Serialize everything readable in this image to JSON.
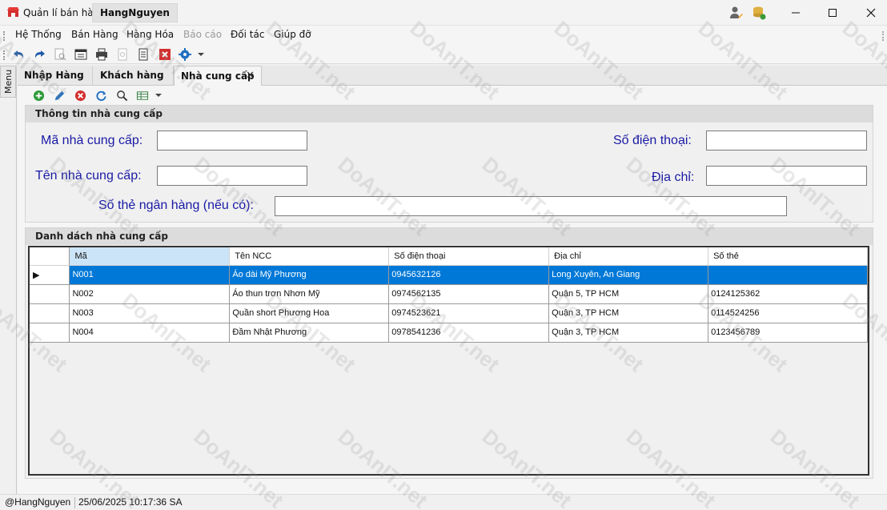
{
  "titlebar": {
    "app_title": "Quản lí bán hàng",
    "user_tab": "HangNguyen"
  },
  "menu": {
    "items": [
      {
        "label": "Hệ Thống",
        "enabled": true
      },
      {
        "label": "Bán Hàng",
        "enabled": true
      },
      {
        "label": "Hàng Hóa",
        "enabled": true
      },
      {
        "label": "Báo cáo",
        "enabled": false
      },
      {
        "label": "Đối tác",
        "enabled": true
      },
      {
        "label": "Giúp đỡ",
        "enabled": true
      }
    ]
  },
  "toolbar": {
    "icons": [
      "undo-icon",
      "redo-icon",
      "print-preview-icon",
      "form-icon",
      "print-icon",
      "page-icon",
      "document-icon",
      "delete-icon",
      "settings-icon",
      "dropdown-arrow-icon"
    ]
  },
  "side_menu": {
    "label": "Menu"
  },
  "tabs": [
    {
      "label": "Nhập Hàng",
      "active": false
    },
    {
      "label": "Khách hàng",
      "active": false
    },
    {
      "label": "Nhà cung cấp",
      "active": true,
      "close": "✕"
    }
  ],
  "content_toolbar": {
    "icons": [
      "add-icon",
      "edit-icon",
      "remove-icon",
      "refresh-icon",
      "search-icon",
      "export-icon",
      "dropdown-arrow-icon"
    ]
  },
  "info_group": {
    "header": "Thông tin nhà cung cấp",
    "labels": {
      "ma": "Mã nhà cung cấp:",
      "ten": "Tên nhà cung cấp:",
      "sdt": "Số điện thoại:",
      "diachi": "Địa chỉ:",
      "sothe": "Số thẻ ngân hàng (nếu có):"
    },
    "values": {
      "ma": "",
      "ten": "",
      "sdt": "",
      "diachi": "",
      "sothe": ""
    }
  },
  "list_group": {
    "header": "Danh dách nhà cung cấp",
    "columns": [
      "Mã",
      "Tên NCC",
      "Số điện thoại",
      "Địa chỉ",
      "Số thẻ"
    ],
    "current_row_marker": "▶",
    "rows": [
      {
        "ma": "N001",
        "ten": "Áo dài Mỹ Phương",
        "sdt": "0945632126",
        "diachi": "Long Xuyên, An Giang",
        "sothe": "",
        "selected": true
      },
      {
        "ma": "N002",
        "ten": "Áo thun trơn Nhơn Mỹ",
        "sdt": "0974562135",
        "diachi": "Quận 5, TP HCM",
        "sothe": "0124125362",
        "selected": false
      },
      {
        "ma": "N003",
        "ten": "Quần short Phương Hoa",
        "sdt": "0974523621",
        "diachi": "Quận 3, TP HCM",
        "sothe": "0114524256",
        "selected": false
      },
      {
        "ma": "N004",
        "ten": "Đầm Nhật Phương",
        "sdt": "0978541236",
        "diachi": "Quận 3, TP HCM",
        "sothe": "0123456789",
        "selected": false
      }
    ]
  },
  "status": {
    "user": "@HangNguyen",
    "datetime": "25/06/2025 10:17:36 SA"
  },
  "watermark": "DoAnIT.net",
  "colors": {
    "accent_blue": "#0078d7",
    "label_blue": "#1a1aa6"
  }
}
